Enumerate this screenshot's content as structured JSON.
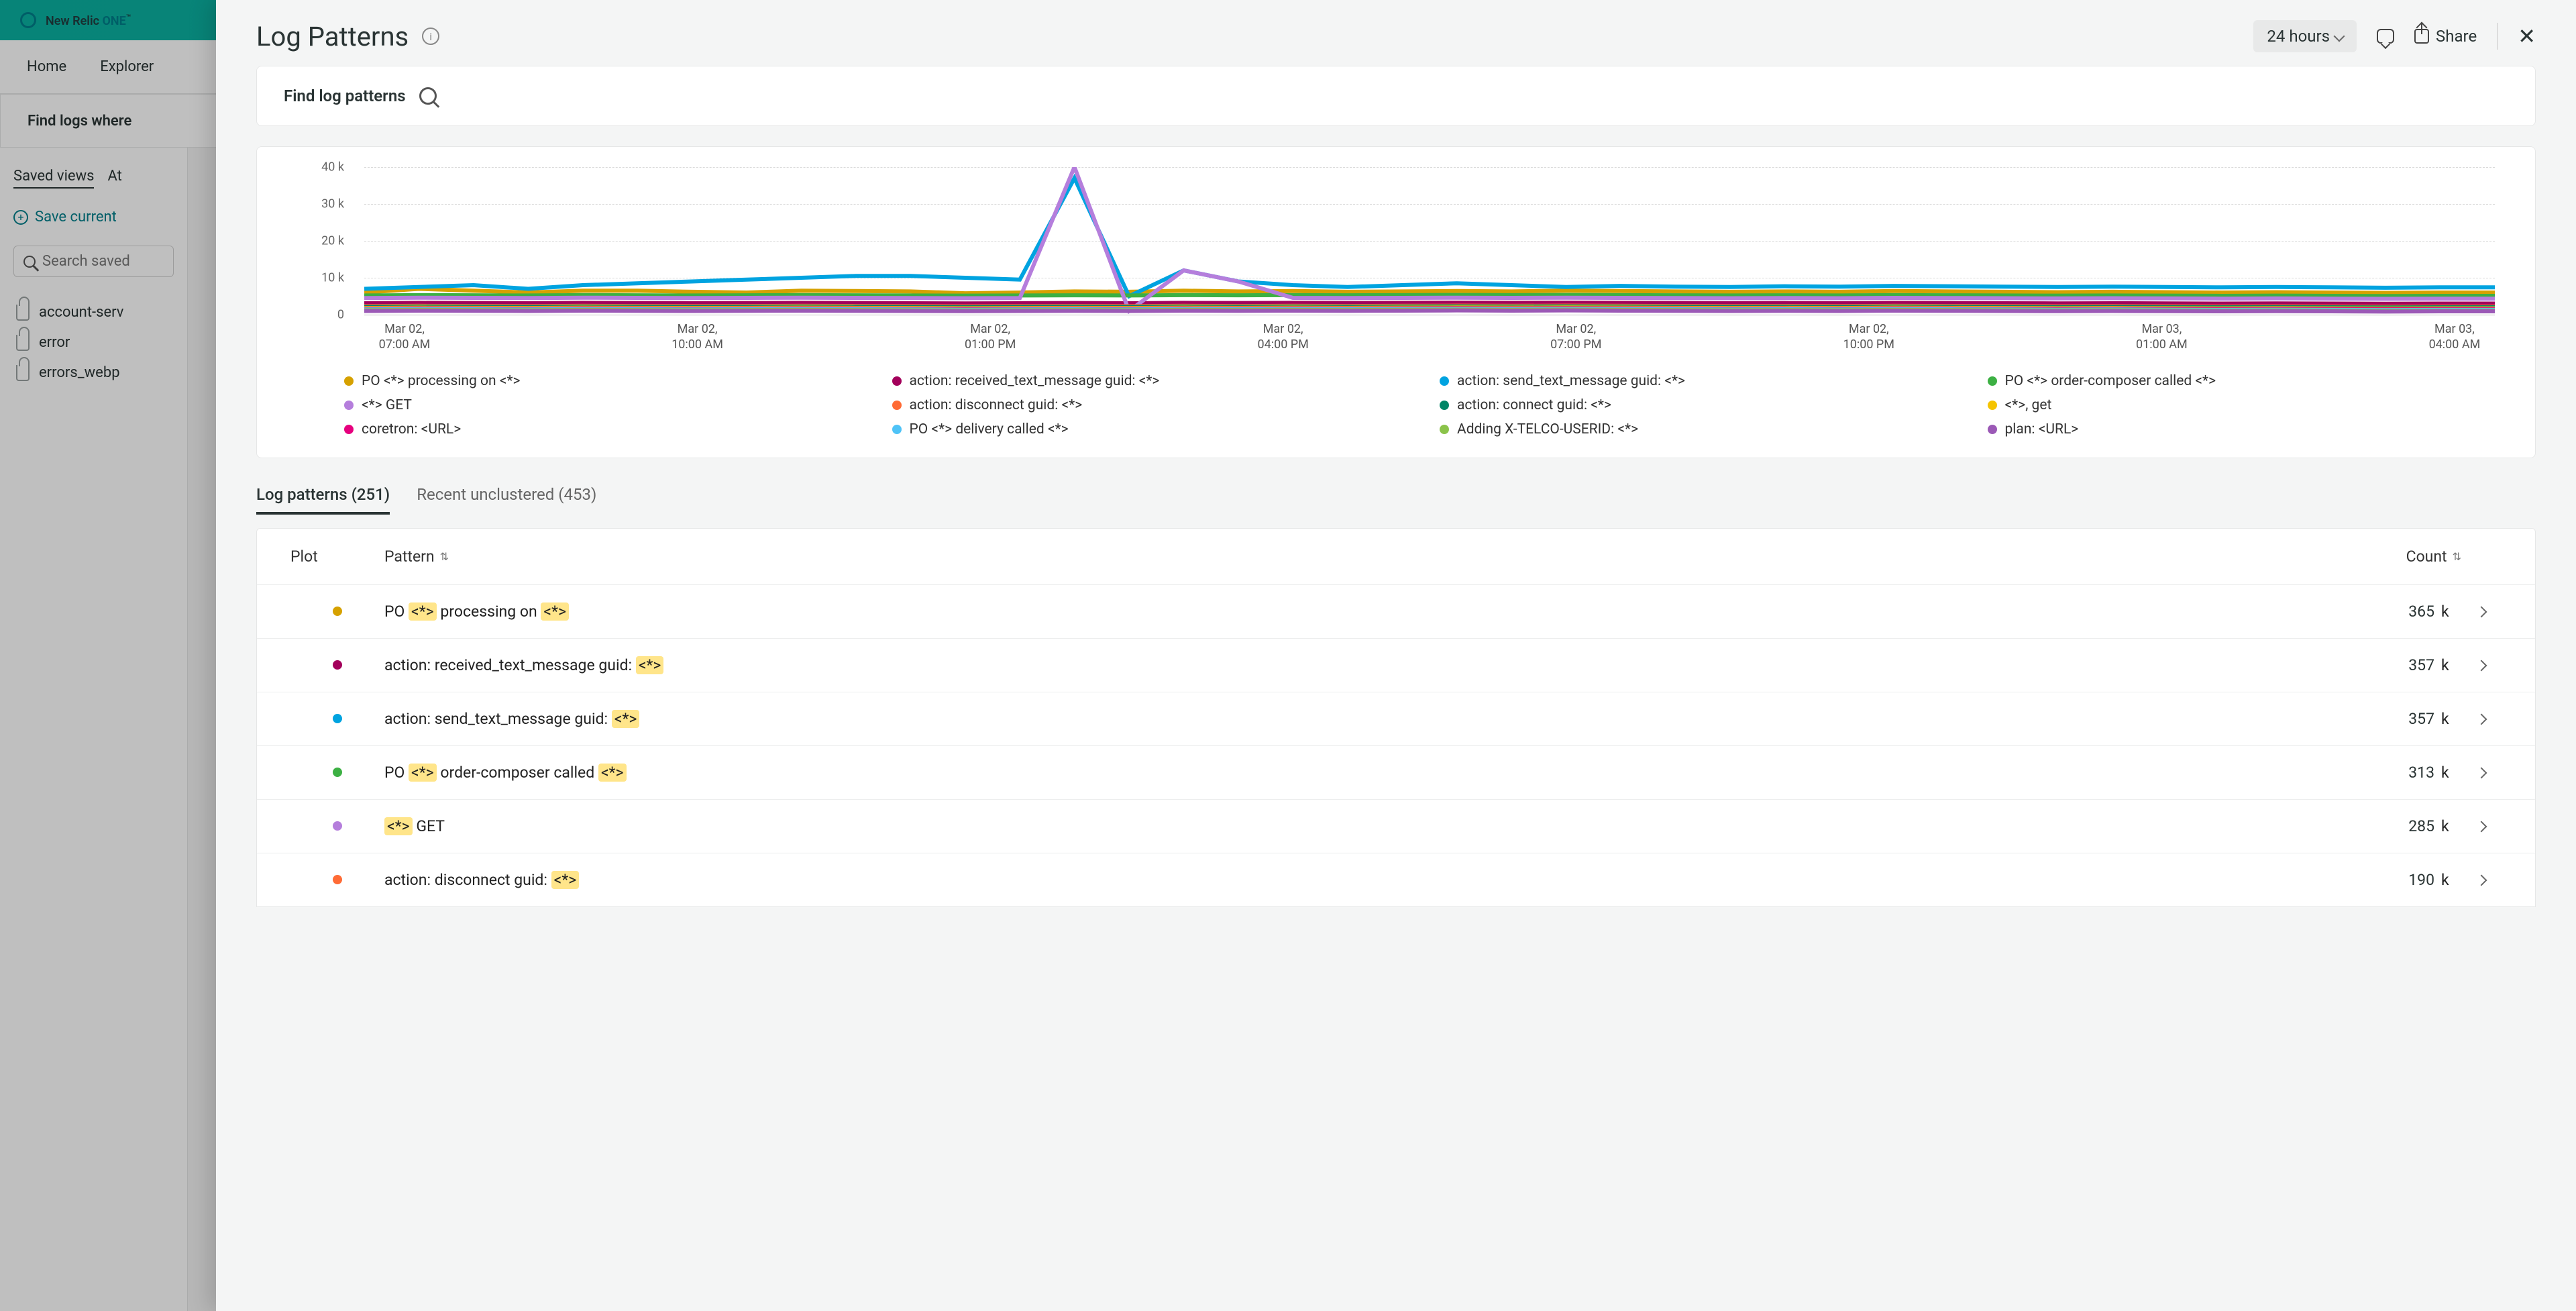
{
  "bg": {
    "brand_prefix": "New Relic ",
    "brand_one": "ONE",
    "brand_tm": "™",
    "nav": [
      "Home",
      "Explorer"
    ],
    "find_bar": "Find logs where",
    "tabs": [
      "Saved views",
      "At"
    ],
    "save_current": "Save current",
    "search_saved_ph": "Search saved",
    "saved_items": [
      "account-serv",
      "error",
      "errors_webp"
    ]
  },
  "panel": {
    "title": "Log Patterns",
    "time_label": "24 hours",
    "share_label": "Share",
    "search_label": "Find log patterns"
  },
  "chart_data": {
    "type": "line",
    "title": "",
    "xlabel": "",
    "ylabel": "",
    "ylim": [
      0,
      40000
    ],
    "y_ticks": [
      "40 k",
      "30 k",
      "20 k",
      "10 k",
      "0"
    ],
    "x_ticks": [
      {
        "l1": "Mar 02,",
        "l2": "07:00 AM"
      },
      {
        "l1": "Mar 02,",
        "l2": "10:00 AM"
      },
      {
        "l1": "Mar 02,",
        "l2": "01:00 PM"
      },
      {
        "l1": "Mar 02,",
        "l2": "04:00 PM"
      },
      {
        "l1": "Mar 02,",
        "l2": "07:00 PM"
      },
      {
        "l1": "Mar 02,",
        "l2": "10:00 PM"
      },
      {
        "l1": "Mar 03,",
        "l2": "01:00 AM"
      },
      {
        "l1": "Mar 03,",
        "l2": "04:00 AM"
      }
    ],
    "series": [
      {
        "name": "PO <*> processing on <*>",
        "color": "#d6a100",
        "values": [
          6000,
          7000,
          6500,
          6000,
          6500,
          6500,
          6200,
          6000,
          6500,
          6400,
          6300,
          5800,
          6000,
          6300,
          6200,
          6500,
          6300,
          6400,
          6200,
          6300,
          6400,
          6300,
          6500,
          6400,
          6300,
          6200,
          6300,
          6200,
          6400,
          6300,
          6200,
          6100,
          6200,
          6100,
          6000,
          6100,
          6000,
          5900,
          6000,
          6000
        ]
      },
      {
        "name": "action: received_text_message guid: <*>",
        "color": "#a3005b",
        "values": [
          3100,
          3200,
          3150,
          3100,
          3200,
          3150,
          3100,
          3150,
          3200,
          3150,
          3100,
          3050,
          3100,
          3150,
          3100,
          3200,
          3150,
          3200,
          3150,
          3200,
          3250,
          3200,
          3250,
          3200,
          3150,
          3100,
          3150,
          3100,
          3200,
          3150,
          3100,
          3050,
          3100,
          3050,
          3000,
          3050,
          3000,
          2950,
          3000,
          3000
        ]
      },
      {
        "name": "action: send_text_message guid: <*>",
        "color": "#00a3e0",
        "values": [
          7000,
          7500,
          8000,
          7000,
          8000,
          8500,
          9000,
          9500,
          10000,
          10500,
          10500,
          10000,
          9500,
          37000,
          5000,
          12000,
          9000,
          8000,
          7500,
          8000,
          8500,
          8000,
          7500,
          7800,
          7600,
          7500,
          7700,
          7600,
          7800,
          7700,
          7600,
          7500,
          7600,
          7500,
          7400,
          7500,
          7400,
          7300,
          7400,
          7400
        ]
      },
      {
        "name": "PO <*> order-composer called <*>",
        "color": "#3cb043",
        "values": [
          5200,
          5300,
          5250,
          5200,
          5300,
          5250,
          5200,
          5250,
          5300,
          5250,
          5200,
          5150,
          5200,
          5250,
          5200,
          5300,
          5250,
          5300,
          5250,
          5300,
          5350,
          5300,
          5350,
          5300,
          5250,
          5200,
          5250,
          5200,
          5300,
          5250,
          5200,
          5150,
          5200,
          5150,
          5100,
          5150,
          5100,
          5050,
          5100,
          5100
        ]
      },
      {
        "name": "<*> GET",
        "color": "#b57edc",
        "values": [
          4500,
          4600,
          4550,
          4500,
          4600,
          4550,
          4500,
          4550,
          4600,
          4550,
          4500,
          4450,
          4500,
          40000,
          1000,
          12000,
          9000,
          4550,
          4500,
          4550,
          4600,
          4550,
          4600,
          4550,
          4500,
          4450,
          4500,
          4450,
          4550,
          4500,
          4450,
          4400,
          4450,
          4400,
          4350,
          4400,
          4350,
          4300,
          4350,
          4350
        ]
      },
      {
        "name": "action: disconnect guid: <*>",
        "color": "#ff6b35",
        "values": [
          2300,
          2400,
          2350,
          2300,
          2400,
          2350,
          2300,
          2350,
          2400,
          2350,
          2300,
          2250,
          2300,
          2350,
          2300,
          2400,
          2350,
          2400,
          2350,
          2400,
          2450,
          2400,
          2450,
          2400,
          2350,
          2300,
          2350,
          2300,
          2400,
          2350,
          2300,
          2250,
          2300,
          2250,
          2200,
          2250,
          2200,
          2150,
          2200,
          2200
        ]
      },
      {
        "name": "action: connect guid: <*>",
        "color": "#008566",
        "values": [
          2100,
          2200,
          2150,
          2100,
          2200,
          2150,
          2100,
          2150,
          2200,
          2150,
          2100,
          2050,
          2100,
          2150,
          2100,
          2200,
          2150,
          2200,
          2150,
          2200,
          2250,
          2200,
          2250,
          2200,
          2150,
          2100,
          2150,
          2100,
          2200,
          2150,
          2100,
          2050,
          2100,
          2050,
          2000,
          2050,
          2000,
          1950,
          2000,
          2000
        ]
      },
      {
        "name": "<*>, get",
        "color": "#f5c400",
        "values": [
          1800,
          1900,
          1850,
          1800,
          1900,
          1850,
          1800,
          1850,
          1900,
          1850,
          1800,
          1750,
          1800,
          1850,
          1800,
          1900,
          1850,
          1900,
          1850,
          1900,
          1950,
          1900,
          1950,
          1900,
          1850,
          1800,
          1850,
          1800,
          1900,
          1850,
          1800,
          1750,
          1800,
          1750,
          1700,
          1750,
          1700,
          1650,
          1700,
          1700
        ]
      },
      {
        "name": "coretron: <URL>",
        "color": "#e6007e",
        "values": [
          1600,
          1700,
          1650,
          1600,
          1700,
          1650,
          1600,
          1650,
          1700,
          1650,
          1600,
          1550,
          1600,
          1650,
          1600,
          1700,
          1650,
          1700,
          1650,
          1700,
          1750,
          1700,
          1750,
          1700,
          1650,
          1600,
          1650,
          1600,
          1700,
          1650,
          1600,
          1550,
          1600,
          1550,
          1500,
          1550,
          1500,
          1450,
          1500,
          1500
        ]
      },
      {
        "name": "PO <*> delivery called <*>",
        "color": "#4fc3f7",
        "values": [
          1400,
          1500,
          1450,
          1400,
          1500,
          1450,
          1400,
          1450,
          1500,
          1450,
          1400,
          1350,
          1400,
          1450,
          1400,
          1500,
          1450,
          1500,
          1450,
          1500,
          1550,
          1500,
          1550,
          1500,
          1450,
          1400,
          1450,
          1400,
          1500,
          1450,
          1400,
          1350,
          1400,
          1350,
          1300,
          1350,
          1300,
          1250,
          1300,
          1300
        ]
      },
      {
        "name": "Adding X-TELCO-USERID: <*>",
        "color": "#8bc34a",
        "values": [
          1200,
          1300,
          1250,
          1200,
          1300,
          1250,
          1200,
          1250,
          1300,
          1250,
          1200,
          1150,
          1200,
          1250,
          1200,
          1300,
          1250,
          1300,
          1250,
          1300,
          1350,
          1300,
          1350,
          1300,
          1250,
          1200,
          1250,
          1200,
          1300,
          1250,
          1200,
          1150,
          1200,
          1150,
          1100,
          1150,
          1100,
          1050,
          1100,
          1100
        ]
      },
      {
        "name": "plan: <URL>",
        "color": "#9b59b6",
        "values": [
          1000,
          1100,
          1050,
          1000,
          1100,
          1050,
          1000,
          1050,
          1100,
          1050,
          1000,
          950,
          1000,
          1050,
          1000,
          1100,
          1050,
          1100,
          1050,
          1100,
          1150,
          1100,
          1150,
          1100,
          1050,
          1000,
          1050,
          1000,
          1100,
          1050,
          1000,
          950,
          1000,
          950,
          900,
          950,
          900,
          850,
          900,
          900
        ]
      }
    ]
  },
  "tabs2": {
    "patterns_label": "Log patterns (251)",
    "unclustered_label": "Recent unclustered (453)"
  },
  "table": {
    "headers": {
      "plot": "Plot",
      "pattern": "Pattern",
      "count": "Count"
    },
    "rows": [
      {
        "color": "#d6a100",
        "parts": [
          "PO ",
          {
            "hl": "<*>"
          },
          " processing on ",
          {
            "hl": "<*>"
          }
        ],
        "count": "365",
        "unit": "k"
      },
      {
        "color": "#a3005b",
        "parts": [
          "action: received_text_message guid: ",
          {
            "hl": "<*>"
          }
        ],
        "count": "357",
        "unit": "k"
      },
      {
        "color": "#00a3e0",
        "parts": [
          "action: send_text_message guid: ",
          {
            "hl": "<*>"
          }
        ],
        "count": "357",
        "unit": "k"
      },
      {
        "color": "#3cb043",
        "parts": [
          "PO ",
          {
            "hl": "<*>"
          },
          " order-composer called ",
          {
            "hl": "<*>"
          }
        ],
        "count": "313",
        "unit": "k"
      },
      {
        "color": "#b57edc",
        "parts": [
          {
            "hl": "<*>"
          },
          " GET"
        ],
        "count": "285",
        "unit": "k"
      },
      {
        "color": "#ff6b35",
        "parts": [
          "action: disconnect guid: ",
          {
            "hl": "<*>"
          }
        ],
        "count": "190",
        "unit": "k"
      }
    ]
  }
}
